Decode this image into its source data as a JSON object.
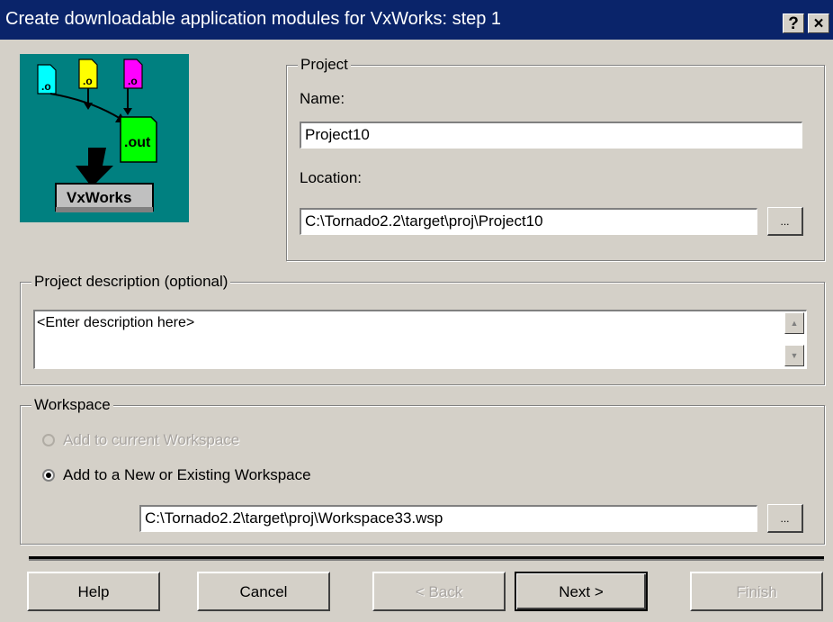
{
  "window": {
    "title": "Create downloadable application modules for VxWorks:  step 1",
    "help_glyph": "?",
    "close_glyph": "×"
  },
  "logo": {
    "file_labels": [
      ".o",
      ".o",
      ".o"
    ],
    "output_label": ".out",
    "target_label": "VxWorks",
    "background_color": "#008080"
  },
  "project": {
    "group_label": "Project",
    "name_label": "Name:",
    "name_value": "Project10",
    "location_label": "Location:",
    "location_value": "C:\\Tornado2.2\\target\\proj\\Project10",
    "browse_label": "..."
  },
  "description": {
    "group_label": "Project description (optional)",
    "value": "<Enter description here>"
  },
  "workspace": {
    "group_label": "Workspace",
    "option_current": "Add to current Workspace",
    "option_new": "Add to a New or Existing Workspace",
    "path_value": "C:\\Tornado2.2\\target\\proj\\Workspace33.wsp",
    "browse_label": "..."
  },
  "buttons": {
    "help": "Help",
    "cancel": "Cancel",
    "back": "< Back",
    "next": "Next >",
    "finish": "Finish"
  }
}
